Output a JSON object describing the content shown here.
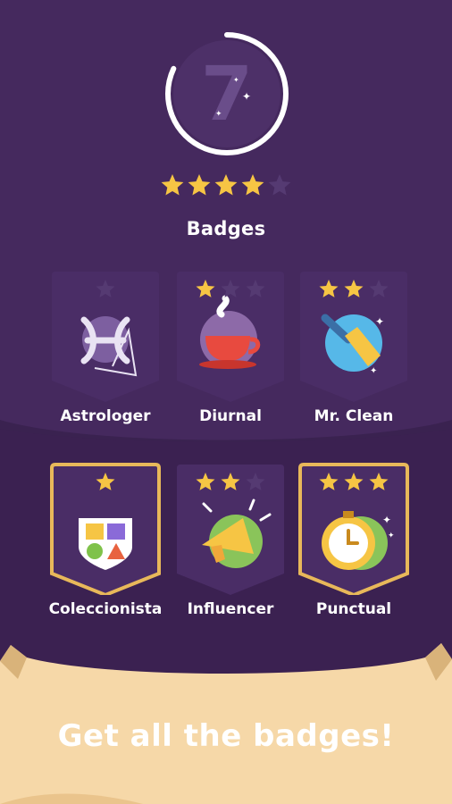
{
  "level": {
    "number": "7",
    "progress": 0.82
  },
  "rating": {
    "filled": 4,
    "total": 5
  },
  "section_title": "Badges",
  "colors": {
    "background": "#3a2250",
    "panel": "#4a2d66",
    "star": "#f6c544",
    "star_empty": "#553a72",
    "gold_border": "#e8b85a",
    "scroll": "#f6d8a8"
  },
  "badges": [
    {
      "label": "Astrologer",
      "stars": 0,
      "max": 1,
      "featured": false,
      "icon": "pisces-constellation-icon"
    },
    {
      "label": "Diurnal",
      "stars": 1,
      "max": 3,
      "featured": false,
      "icon": "coffee-cup-icon"
    },
    {
      "label": "Mr. Clean",
      "stars": 2,
      "max": 3,
      "featured": false,
      "icon": "broom-icon"
    },
    {
      "label": "Coleccionista",
      "stars": 1,
      "max": 1,
      "featured": true,
      "icon": "collection-shield-icon"
    },
    {
      "label": "Influencer",
      "stars": 2,
      "max": 3,
      "featured": false,
      "icon": "megaphone-icon"
    },
    {
      "label": "Punctual",
      "stars": 3,
      "max": 3,
      "featured": true,
      "icon": "stopwatch-icon"
    }
  ],
  "cta_text": "Get all the badges!"
}
